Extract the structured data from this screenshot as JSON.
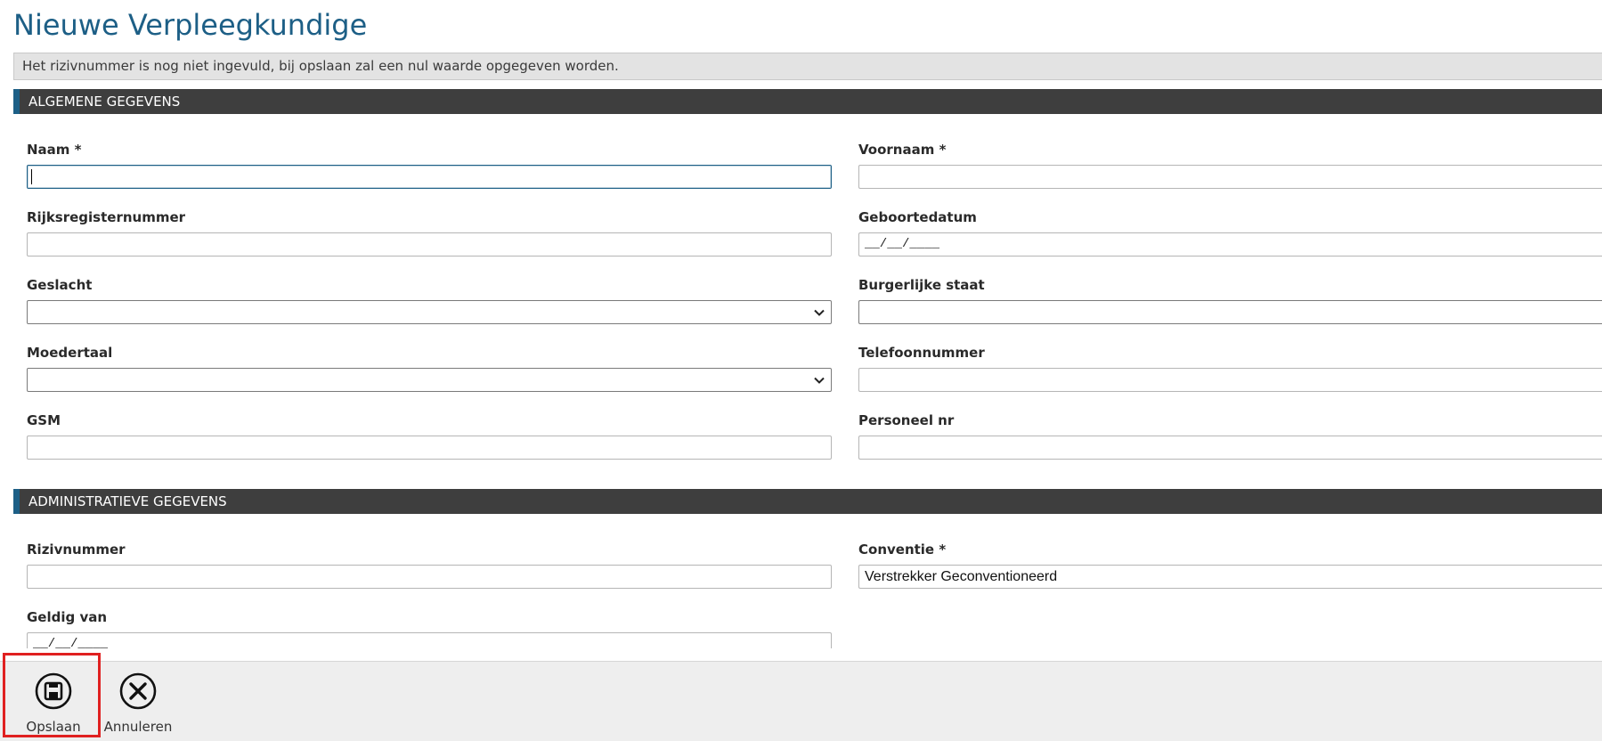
{
  "page": {
    "title": "Nieuwe Verpleegkundige",
    "notice": "Het rizivnummer is nog niet ingevuld, bij opslaan zal een nul waarde opgegeven worden."
  },
  "sections": {
    "general": "ALGEMENE GEGEVENS",
    "administrative": "ADMINISTRATIEVE GEGEVENS"
  },
  "fields": {
    "naam": {
      "label": "Naam *",
      "value": ""
    },
    "voornaam": {
      "label": "Voornaam *",
      "value": ""
    },
    "rijksregisternummer": {
      "label": "Rijksregisternummer",
      "value": ""
    },
    "geboortedatum": {
      "label": "Geboortedatum",
      "value": "__/__/____"
    },
    "geslacht": {
      "label": "Geslacht",
      "value": ""
    },
    "burgerlijke_staat": {
      "label": "Burgerlijke staat",
      "value": ""
    },
    "moedertaal": {
      "label": "Moedertaal",
      "value": ""
    },
    "telefoonnummer": {
      "label": "Telefoonnummer",
      "value": ""
    },
    "gsm": {
      "label": "GSM",
      "value": ""
    },
    "personeel_nr": {
      "label": "Personeel nr",
      "value": ""
    },
    "rizivnummer": {
      "label": "Rizivnummer",
      "value": ""
    },
    "conventie": {
      "label": "Conventie *",
      "value": "Verstrekker Geconventioneerd"
    },
    "geldig_van": {
      "label": "Geldig van",
      "value": "__/__/____"
    }
  },
  "toolbar": {
    "save_label": "Opslaan",
    "cancel_label": "Annuleren",
    "save_icon": "floppy-disk-icon",
    "cancel_icon": "close-circle-icon"
  },
  "colors": {
    "accent": "#1d5f86",
    "section_bar": "#3e3e3e",
    "notice_bg": "#e3e3e3",
    "footer_bg": "#eeeeee",
    "highlight": "#e02020"
  }
}
